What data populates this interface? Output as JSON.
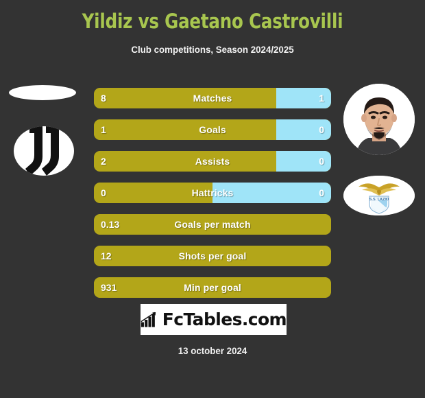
{
  "header": {
    "title": "Yildiz vs Gaetano Castrovilli",
    "subtitle": "Club competitions, Season 2024/2025",
    "title_color": "#a8c64f"
  },
  "teams": {
    "left": {
      "crest_name": "juventus-crest"
    },
    "right": {
      "crest_name": "lazio-crest",
      "photo_name": "player-photo"
    }
  },
  "colors": {
    "background": "#333333",
    "bar_gold": "#b3a619",
    "bar_blue": "#9fe4f8",
    "text": "#ffffff"
  },
  "chart_data": {
    "type": "bar",
    "title": "Yildiz vs Gaetano Castrovilli",
    "subtitle": "Club competitions, Season 2024/2025",
    "orientation": "horizontal-diverging",
    "series": [
      {
        "name": "Yildiz",
        "color": "#b3a619",
        "side": "left"
      },
      {
        "name": "Gaetano Castrovilli",
        "color": "#9fe4f8",
        "side": "right"
      }
    ],
    "categories": [
      "Matches",
      "Goals",
      "Assists",
      "Hattricks",
      "Goals per match",
      "Shots per goal",
      "Min per goal"
    ],
    "rows": [
      {
        "label": "Matches",
        "left_value": "8",
        "right_value": "1",
        "left_pct": 77,
        "right_pct": 23,
        "two_sided": true
      },
      {
        "label": "Goals",
        "left_value": "1",
        "right_value": "0",
        "left_pct": 77,
        "right_pct": 23,
        "two_sided": true
      },
      {
        "label": "Assists",
        "left_value": "2",
        "right_value": "0",
        "left_pct": 77,
        "right_pct": 23,
        "two_sided": true
      },
      {
        "label": "Hattricks",
        "left_value": "0",
        "right_value": "0",
        "left_pct": 50,
        "right_pct": 50,
        "two_sided": true
      },
      {
        "label": "Goals per match",
        "left_value": "0.13",
        "right_value": "",
        "left_pct": 100,
        "right_pct": 0,
        "two_sided": false
      },
      {
        "label": "Shots per goal",
        "left_value": "12",
        "right_value": "",
        "left_pct": 100,
        "right_pct": 0,
        "two_sided": false
      },
      {
        "label": "Min per goal",
        "left_value": "931",
        "right_value": "",
        "left_pct": 100,
        "right_pct": 0,
        "two_sided": false
      }
    ]
  },
  "footer": {
    "brand": "FcTables.com",
    "brand_icon": "bar-chart-growth-icon",
    "date": "13 october 2024"
  }
}
